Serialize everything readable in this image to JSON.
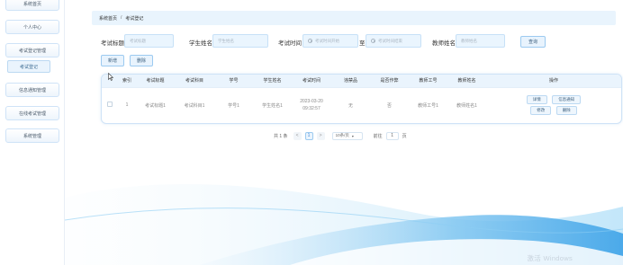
{
  "sidebar": {
    "items": [
      {
        "label": "系统首页"
      },
      {
        "label": "个人中心"
      },
      {
        "label": "考试登记管理"
      },
      {
        "label": "信息通知管理"
      },
      {
        "label": "在线考试管理"
      },
      {
        "label": "系统管理"
      }
    ],
    "sub_items": [
      {
        "label": "考试登记"
      }
    ]
  },
  "breadcrumb": {
    "home": "系统首页",
    "separator": "/",
    "current": "考试登记"
  },
  "search": {
    "title_label": "考试标题",
    "title_placeholder": "考试标题",
    "student_label": "学生姓名",
    "student_placeholder": "学生姓名",
    "time_label": "考试时间",
    "time_start_placeholder": "考试时间开始",
    "range_sep": "至",
    "time_end_placeholder": "考试时间结束",
    "teacher_label": "教师姓名",
    "teacher_placeholder": "教师姓名",
    "query_button": "查询"
  },
  "actions": {
    "add_button": "新增",
    "delete_button": "删除"
  },
  "table": {
    "columns": [
      "索引",
      "考试标题",
      "考试科目",
      "学号",
      "学生姓名",
      "考试时间",
      "违禁品",
      "是否作弊",
      "教师工号",
      "教师姓名",
      "操作"
    ],
    "rows": [
      {
        "index": "1",
        "title": "考试标题1",
        "subject": "考试科目1",
        "student_id": "学号1",
        "student_name": "学生姓名1",
        "exam_time": "2023-03-20 09:32:57",
        "contraband": "无",
        "cheated": "否",
        "teacher_id": "教师工号1",
        "teacher_name": "教师姓名1",
        "ops": {
          "detail": "详情",
          "notify": "信息通知",
          "edit": "修改",
          "delete": "删除"
        }
      }
    ]
  },
  "pagination": {
    "total": "共 1 条",
    "prev": "<",
    "current_page": "1",
    "next": ">",
    "page_size": "10条/页",
    "goto_label": "前往",
    "goto_value": "1",
    "page_unit": "页"
  },
  "watermark": "激活 Windows",
  "colors": {
    "accent": "#3a86d6",
    "header_bg": "#eaf4fd",
    "border": "#cfe3f7"
  }
}
